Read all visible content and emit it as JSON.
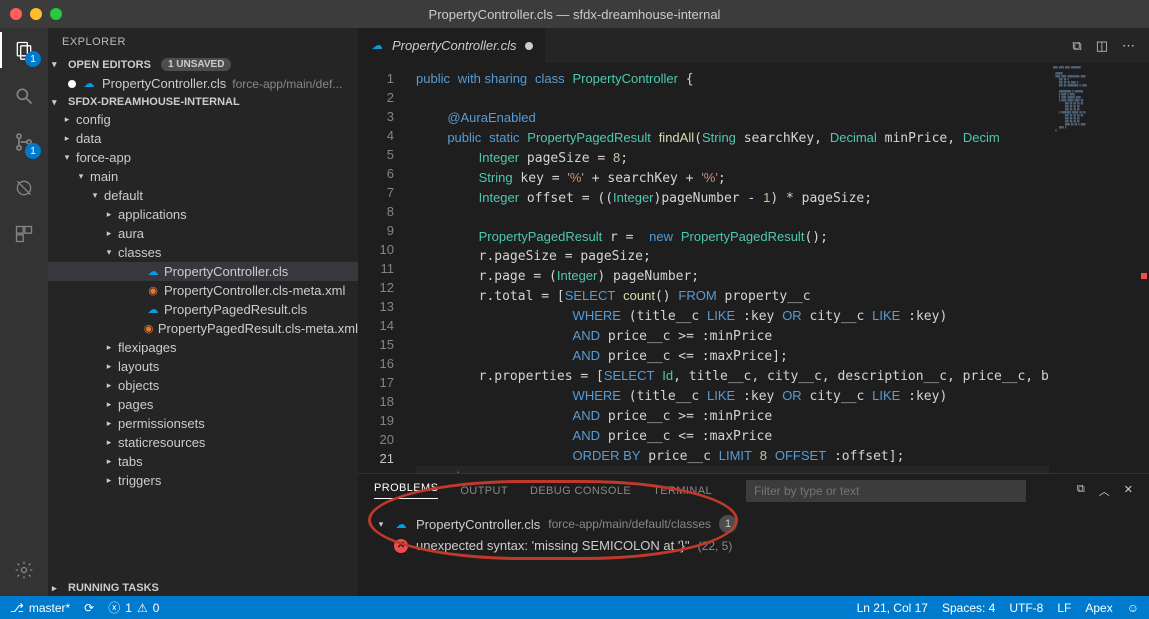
{
  "window": {
    "title": "PropertyController.cls — sfdx-dreamhouse-internal"
  },
  "activityBar": {
    "badge1": "1",
    "badge2": "1"
  },
  "explorer": {
    "title": "EXPLORER",
    "openEditors": {
      "label": "OPEN EDITORS",
      "unsaved": "1 UNSAVED"
    },
    "openFile": {
      "name": "PropertyController.cls",
      "path": "force-app/main/def..."
    },
    "workspace": "SFDX-DREAMHOUSE-INTERNAL",
    "tree": [
      {
        "l": 1,
        "c": "▸",
        "label": "config"
      },
      {
        "l": 1,
        "c": "▸",
        "label": "data"
      },
      {
        "l": 1,
        "c": "▾",
        "label": "force-app"
      },
      {
        "l": 2,
        "c": "▾",
        "label": "main"
      },
      {
        "l": 3,
        "c": "▾",
        "label": "default"
      },
      {
        "l": 4,
        "c": "▸",
        "label": "applications"
      },
      {
        "l": 4,
        "c": "▸",
        "label": "aura"
      },
      {
        "l": 4,
        "c": "▾",
        "label": "classes"
      },
      {
        "l": 5,
        "c": "",
        "icon": "sf",
        "label": "PropertyController.cls",
        "sel": true
      },
      {
        "l": 5,
        "c": "",
        "icon": "xml",
        "label": "PropertyController.cls-meta.xml"
      },
      {
        "l": 5,
        "c": "",
        "icon": "sf",
        "label": "PropertyPagedResult.cls"
      },
      {
        "l": 5,
        "c": "",
        "icon": "xml",
        "label": "PropertyPagedResult.cls-meta.xml"
      },
      {
        "l": 4,
        "c": "▸",
        "label": "flexipages"
      },
      {
        "l": 4,
        "c": "▸",
        "label": "layouts"
      },
      {
        "l": 4,
        "c": "▸",
        "label": "objects"
      },
      {
        "l": 4,
        "c": "▸",
        "label": "pages"
      },
      {
        "l": 4,
        "c": "▸",
        "label": "permissionsets"
      },
      {
        "l": 4,
        "c": "▸",
        "label": "staticresources"
      },
      {
        "l": 4,
        "c": "▸",
        "label": "tabs"
      },
      {
        "l": 4,
        "c": "▸",
        "label": "triggers"
      }
    ],
    "runningTasks": "RUNNING TASKS"
  },
  "editor": {
    "tab": "PropertyController.cls",
    "lines": 23,
    "code": [
      "<span class='k'>public</span> <span class='k'>with sharing</span> <span class='k'>class</span> <span class='ty'>PropertyController</span> {",
      "",
      "    <span class='an'>@AuraEnabled</span>",
      "    <span class='k'>public</span> <span class='k'>static</span> <span class='ty'>PropertyPagedResult</span> <span class='fn'>findAll</span>(<span class='ty'>String</span> searchKey, <span class='ty'>Decimal</span> minPrice, <span class='ty'>Decim</span>",
      "        <span class='ty'>Integer</span> pageSize = <span class='nm'>8</span>;",
      "        <span class='ty'>String</span> key = <span class='st'>'%'</span> + searchKey + <span class='st'>'%'</span>;",
      "        <span class='ty'>Integer</span> offset = ((<span class='ty'>Integer</span>)pageNumber - <span class='nm'>1</span>) * pageSize;",
      "",
      "        <span class='ty'>PropertyPagedResult</span> r =  <span class='k'>new</span> <span class='ty'>PropertyPagedResult</span>();",
      "        r.pageSize = pageSize;",
      "        r.page = (<span class='ty'>Integer</span>) pageNumber;",
      "        r.total = [<span class='k'>SELECT</span> <span class='fn'>count</span>() <span class='k'>FROM</span> property__c",
      "                    <span class='k'>WHERE</span> (title__c <span class='k'>LIKE</span> :key <span class='k'>OR</span> city__c <span class='k'>LIKE</span> :key)",
      "                    <span class='k'>AND</span> price__c &gt;= :minPrice",
      "                    <span class='k'>AND</span> price__c &lt;= :maxPrice];",
      "        r.properties = [<span class='k'>SELECT</span> <span class='ty'>Id</span>, title__c, city__c, description__c, price__c, baths__",
      "                    <span class='k'>WHERE</span> (title__c <span class='k'>LIKE</span> :key <span class='k'>OR</span> city__c <span class='k'>LIKE</span> :key)",
      "                    <span class='k'>AND</span> price__c &gt;= :minPrice",
      "                    <span class='k'>AND</span> price__c &lt;= :maxPrice",
      "                    <span class='k'>ORDER BY</span> price__c <span class='k'>LIMIT</span> <span class='nm'>8</span> <span class='k'>OFFSET</span> :offset];",
      "        <span class='k'>return</span> r",
      "    }",
      ""
    ]
  },
  "panel": {
    "tabs": {
      "problems": "PROBLEMS",
      "output": "OUTPUT",
      "debug": "DEBUG CONSOLE",
      "terminal": "TERMINAL"
    },
    "filterPlaceholder": "Filter by type or text",
    "file": "PropertyController.cls",
    "filePath": "force-app/main/default/classes",
    "count": "1",
    "error": "unexpected syntax: 'missing SEMICOLON at '}''",
    "loc": "(22, 5)"
  },
  "status": {
    "branch": "master*",
    "sync": "",
    "errors": "1",
    "warnings": "0",
    "lncol": "Ln 21, Col 17",
    "spaces": "Spaces: 4",
    "encoding": "UTF-8",
    "eol": "LF",
    "lang": "Apex"
  }
}
